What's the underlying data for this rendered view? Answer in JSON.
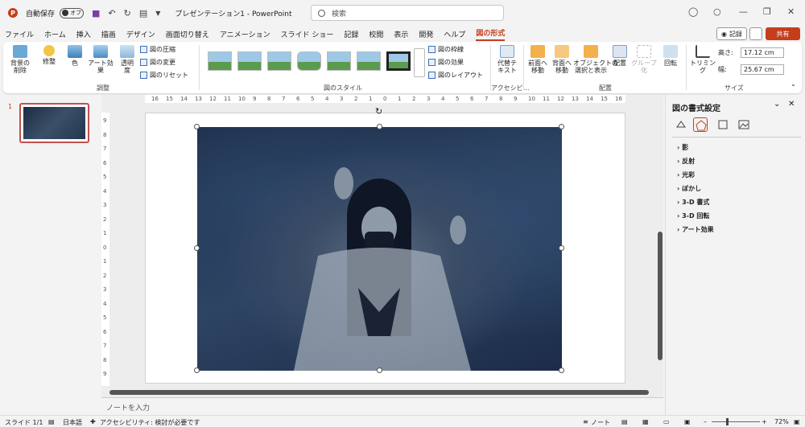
{
  "titlebar": {
    "autosave_label": "自動保存",
    "autosave_state": "オフ",
    "document_title": "プレゼンテーション1 - PowerPoint"
  },
  "search": {
    "placeholder": "検索"
  },
  "menu": {
    "tabs": [
      "ファイル",
      "ホーム",
      "挿入",
      "描画",
      "デザイン",
      "画面切り替え",
      "アニメーション",
      "スライド ショー",
      "記録",
      "校閲",
      "表示",
      "開発",
      "ヘルプ",
      "図の形式"
    ],
    "active_tab": "図の形式",
    "record_label": "記録",
    "share_label": "共有"
  },
  "ribbon": {
    "remove_bg": "背景の\n削除",
    "corrections": "修整",
    "color": "色",
    "artistic": "アート効果",
    "transparency": "透明\n度",
    "compress": "図の圧縮",
    "change": "図の変更",
    "reset": "図のリセット",
    "adjust_group": "調整",
    "style_group": "図のスタイル",
    "border": "図の枠線",
    "effects": "図の効果",
    "layout": "図のレイアウト",
    "alt_text": "代替テ\nキスト",
    "accessibility_group": "アクセシビ…",
    "bring_forward": "前面へ\n移動",
    "send_backward": "背面へ\n移動",
    "selection_pane": "オブジェクトの\n選択と表示",
    "align": "配置",
    "group": "グループ化",
    "rotate": "回転",
    "arrange_group": "配置",
    "crop": "トリミング",
    "height_label": "高さ:",
    "height_value": "17.12 cm",
    "width_label": "幅:",
    "width_value": "25.67 cm",
    "size_group": "サイズ"
  },
  "slides": {
    "number": "1"
  },
  "ruler": {
    "h_ticks": [
      "16",
      "15",
      "14",
      "13",
      "12",
      "11",
      "10",
      "9",
      "8",
      "7",
      "6",
      "5",
      "4",
      "3",
      "2",
      "1",
      "0",
      "1",
      "2",
      "3",
      "4",
      "5",
      "6",
      "7",
      "8",
      "9",
      "10",
      "11",
      "12",
      "13",
      "14",
      "15",
      "16"
    ],
    "v_ticks": [
      "9",
      "8",
      "7",
      "6",
      "5",
      "4",
      "3",
      "2",
      "1",
      "0",
      "1",
      "2",
      "3",
      "4",
      "5",
      "6",
      "7",
      "8",
      "9"
    ]
  },
  "notes": {
    "placeholder": "ノートを入力"
  },
  "format_pane": {
    "title": "図の書式設定",
    "items": [
      "影",
      "反射",
      "光彩",
      "ぼかし",
      "3-D 書式",
      "3-D 回転",
      "アート効果"
    ]
  },
  "status": {
    "slide_info": "スライド 1/1",
    "language": "日本語",
    "accessibility": "アクセシビリティ: 検討が必要です",
    "notes_label": "ノート",
    "zoom": "72%"
  }
}
